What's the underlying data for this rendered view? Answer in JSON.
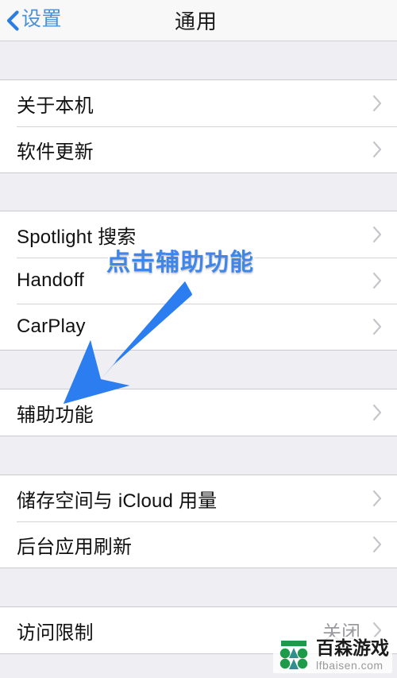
{
  "navbar": {
    "back_label": "设置",
    "back_icon": "chevron-left-icon",
    "title": "通用"
  },
  "colors": {
    "accent_blue": "#4a90d9",
    "annotation_blue": "#3e86ea",
    "arrow_blue": "#2b7df0",
    "chevron_gray": "#c7c7cc",
    "value_gray": "#9b9b9f",
    "page_background": "#eeeef3",
    "row_background": "#ffffff",
    "logo_green": "#1d9a4a",
    "logo_teal": "#2f8f8f"
  },
  "groups": [
    {
      "name": "device-group",
      "rows": [
        {
          "label": "关于本机",
          "value": "",
          "accessory": "chevron-right-icon"
        },
        {
          "label": "软件更新",
          "value": "",
          "accessory": "chevron-right-icon"
        }
      ]
    },
    {
      "name": "features-group",
      "rows": [
        {
          "label": "Spotlight 搜索",
          "value": "",
          "accessory": "chevron-right-icon"
        },
        {
          "label": "Handoff",
          "value": "",
          "accessory": "chevron-right-icon"
        },
        {
          "label": "CarPlay",
          "value": "",
          "accessory": "chevron-right-icon"
        }
      ]
    },
    {
      "name": "accessibility-group",
      "rows": [
        {
          "label": "辅助功能",
          "value": "",
          "accessory": "chevron-right-icon"
        }
      ]
    },
    {
      "name": "storage-group",
      "rows": [
        {
          "label": "储存空间与 iCloud 用量",
          "value": "",
          "accessory": "chevron-right-icon"
        },
        {
          "label": "后台应用刷新",
          "value": "",
          "accessory": "chevron-right-icon"
        }
      ]
    },
    {
      "name": "restrictions-group",
      "rows": [
        {
          "label": "访问限制",
          "value": "关闭",
          "accessory": "chevron-right-icon"
        }
      ]
    }
  ],
  "annotation": {
    "text": "点击辅助功能",
    "arrow_icon": "arrow-down-left-icon",
    "points_to": "辅助功能"
  },
  "watermark": {
    "brand": "百森游戏",
    "url": "lfbaisen.com",
    "logo_icon": "baisen-logo-icon"
  }
}
